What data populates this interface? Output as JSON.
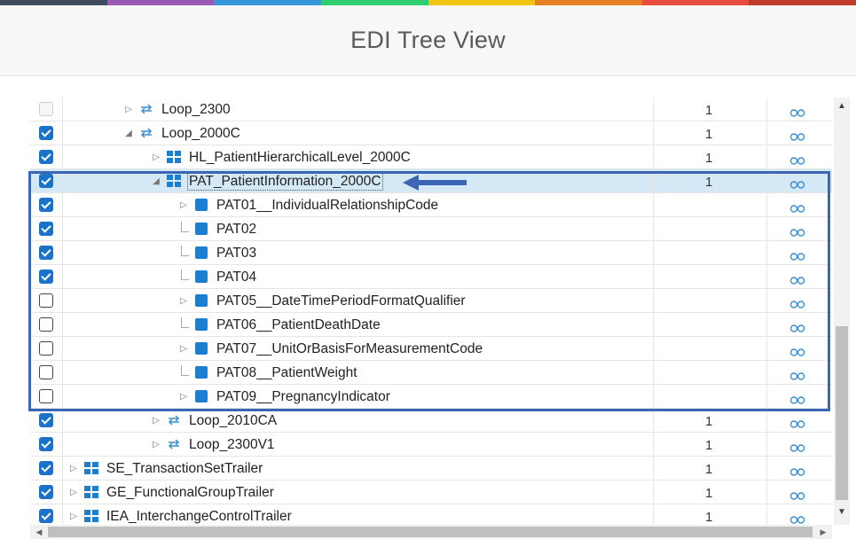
{
  "window": {
    "title": "EDI Tree View"
  },
  "accent_colors": [
    "#3d4b5c",
    "#9b59b6",
    "#3498db",
    "#2ecc71",
    "#f1c40f",
    "#e67e22",
    "#e74c3c",
    "#c0392b"
  ],
  "selection_color": "#d5e8f6",
  "highlight_color": "#3b66b7",
  "rows": [
    {
      "label": "Loop_2300",
      "count": "1",
      "checked": false,
      "disabled": true,
      "level": 3,
      "icon": "loop-icon",
      "toggle": "collapsed"
    },
    {
      "label": "Loop_2000C",
      "count": "1",
      "checked": true,
      "level": 3,
      "icon": "loop-icon",
      "toggle": "expanded"
    },
    {
      "label": "HL_PatientHierarchicalLevel_2000C",
      "count": "1",
      "checked": true,
      "level": 4,
      "icon": "segment-icon",
      "toggle": "collapsed"
    },
    {
      "label": "PAT_PatientInformation_2000C",
      "count": "1",
      "checked": true,
      "level": 4,
      "icon": "segment-icon",
      "toggle": "expanded",
      "selected": true
    },
    {
      "label": "PAT01__IndividualRelationshipCode",
      "count": "",
      "checked": true,
      "level": 5,
      "icon": "element-icon",
      "toggle": "collapsed"
    },
    {
      "label": "PAT02",
      "count": "",
      "checked": true,
      "level": 5,
      "icon": "element-icon",
      "toggle": "leaf"
    },
    {
      "label": "PAT03",
      "count": "",
      "checked": true,
      "level": 5,
      "icon": "element-icon",
      "toggle": "leaf"
    },
    {
      "label": "PAT04",
      "count": "",
      "checked": true,
      "level": 5,
      "icon": "element-icon",
      "toggle": "leaf"
    },
    {
      "label": "PAT05__DateTimePeriodFormatQualifier",
      "count": "",
      "checked": false,
      "level": 5,
      "icon": "element-icon",
      "toggle": "collapsed"
    },
    {
      "label": "PAT06__PatientDeathDate",
      "count": "",
      "checked": false,
      "level": 5,
      "icon": "element-icon",
      "toggle": "leaf"
    },
    {
      "label": "PAT07__UnitOrBasisForMeasurementCode",
      "count": "",
      "checked": false,
      "level": 5,
      "icon": "element-icon",
      "toggle": "collapsed"
    },
    {
      "label": "PAT08__PatientWeight",
      "count": "",
      "checked": false,
      "level": 5,
      "icon": "element-icon",
      "toggle": "leaf"
    },
    {
      "label": "PAT09__PregnancyIndicator",
      "count": "",
      "checked": false,
      "level": 5,
      "icon": "element-icon",
      "toggle": "collapsed"
    },
    {
      "label": "Loop_2010CA",
      "count": "1",
      "checked": true,
      "level": 4,
      "icon": "loop-icon",
      "toggle": "collapsed"
    },
    {
      "label": "Loop_2300V1",
      "count": "1",
      "checked": true,
      "level": 4,
      "icon": "loop-icon",
      "toggle": "collapsed"
    },
    {
      "label": "SE_TransactionSetTrailer",
      "count": "1",
      "checked": true,
      "level": 1,
      "icon": "segment-icon",
      "toggle": "collapsed"
    },
    {
      "label": "GE_FunctionalGroupTrailer",
      "count": "1",
      "checked": true,
      "level": 1,
      "icon": "segment-icon",
      "toggle": "collapsed"
    },
    {
      "label": "IEA_InterchangeControlTrailer",
      "count": "1",
      "checked": true,
      "level": 1,
      "icon": "segment-icon",
      "toggle": "collapsed"
    }
  ]
}
